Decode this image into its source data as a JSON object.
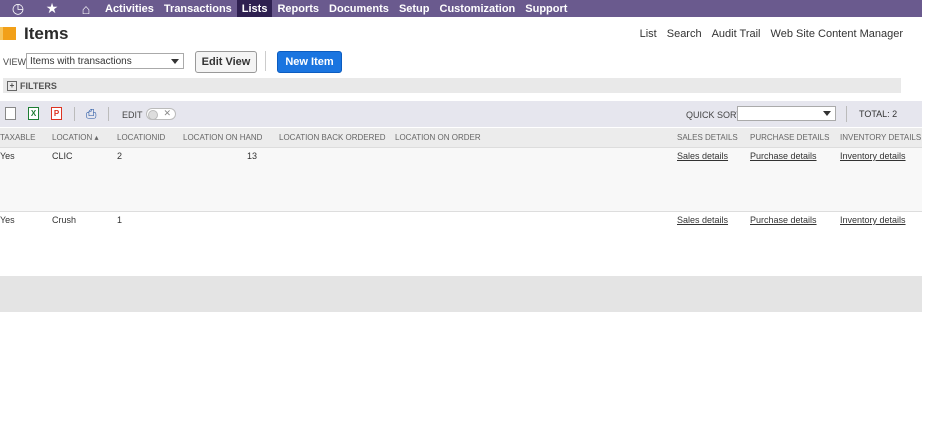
{
  "nav": {
    "items": [
      "Activities",
      "Transactions",
      "Lists",
      "Reports",
      "Documents",
      "Setup",
      "Customization",
      "Support"
    ],
    "active": "Lists"
  },
  "page": {
    "title": "Items",
    "links": [
      "List",
      "Search",
      "Audit Trail",
      "Web Site Content Manager"
    ]
  },
  "view": {
    "label": "VIEW",
    "selected": "Items with transactions",
    "edit_view": "Edit View",
    "new_item": "New Item"
  },
  "filters": {
    "label": "FILTERS"
  },
  "toolbar": {
    "edit_label": "EDIT",
    "quick_sort_label": "QUICK SORT",
    "quick_sort_value": "",
    "total": "TOTAL: 2"
  },
  "table": {
    "columns": [
      "TAXABLE",
      "LOCATION ▴",
      "LOCATIONID",
      "LOCATION ON HAND",
      "LOCATION BACK ORDERED",
      "LOCATION ON ORDER",
      "SALES DETAILS",
      "PURCHASE DETAILS",
      "INVENTORY DETAILS"
    ],
    "rows": [
      {
        "taxable": "Yes",
        "location": "CLIC",
        "locationid": "2",
        "on_hand": "13",
        "back_ordered": "",
        "on_order": "",
        "sales": "Sales details",
        "purchase": "Purchase details",
        "inventory": "Inventory details"
      },
      {
        "taxable": "Yes",
        "location": "Crush",
        "locationid": "1",
        "on_hand": "",
        "back_ordered": "",
        "on_order": "",
        "sales": "Sales details",
        "purchase": "Purchase details",
        "inventory": "Inventory details"
      }
    ]
  },
  "colors": {
    "nav_bg": "#6a5a8e",
    "nav_active": "#2e2050",
    "primary": "#1a75e0"
  }
}
